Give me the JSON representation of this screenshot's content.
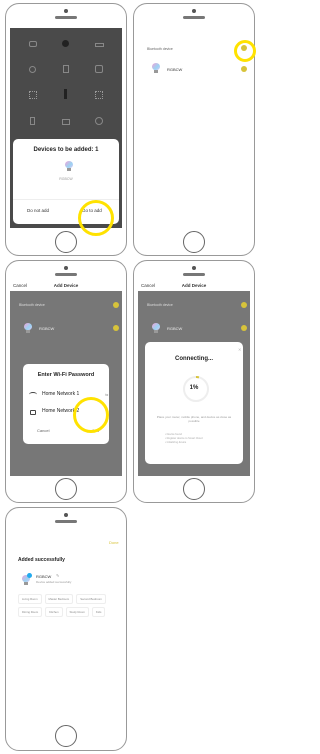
{
  "p1": {
    "grid": [
      "",
      "",
      "",
      "",
      "",
      "",
      "",
      "",
      "",
      "",
      "",
      "",
      "",
      "",
      ""
    ],
    "dialog_title": "Devices to be added: 1",
    "device_name": "RGBCW",
    "do_not_add": "Do not add",
    "go_to_add": "Go to add"
  },
  "p2": {
    "section": "Bluetooth device",
    "device_name": "RGBCW"
  },
  "p3": {
    "cancel": "Cancel",
    "title": "Add Device",
    "section": "Bluetooth device",
    "device_name": "RGBCW",
    "dialog_title": "Enter Wi-Fi Password",
    "network": "Home Network 1",
    "password": "Home Network 2",
    "cancel_btn": "Cancel",
    "confirm_btn": "Confirm"
  },
  "p4": {
    "cancel": "Cancel",
    "title": "Add Device",
    "section": "Bluetooth device",
    "device_name": "RGBCW",
    "dialog_title": "Connecting...",
    "progress_label": "1%",
    "progress": 0.01,
    "hint": "Place your router, mobile phone, and device as close as possible",
    "steps": [
      "Device found",
      "Register device to Smart Cloud",
      "Initializing device"
    ]
  },
  "p5": {
    "done": "Done",
    "title": "Added successfully",
    "device_name": "RGBCW",
    "status": "Device added successfully",
    "rooms": [
      "Living Room",
      "Master Bedroom",
      "Second Bedroom",
      "Dining Room",
      "Kitchen",
      "Study Room",
      "Kids"
    ]
  }
}
